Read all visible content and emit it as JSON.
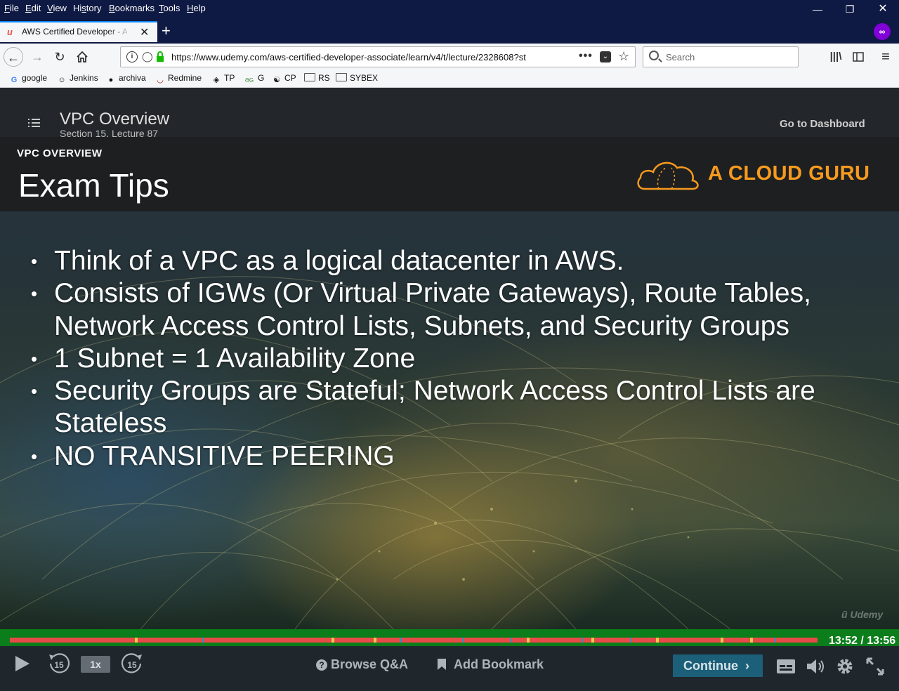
{
  "browser": {
    "menu": [
      "File",
      "Edit",
      "View",
      "History",
      "Bookmarks",
      "Tools",
      "Help"
    ],
    "menu_mnemonic": [
      "F",
      "E",
      "V",
      "s",
      "B",
      "T",
      "H"
    ],
    "tab": {
      "title": "AWS Certified Developer - A",
      "favicon": "u"
    },
    "url": "https://www.udemy.com/aws-certified-developer-associate/learn/v4/t/lecture/2328608?st",
    "search_placeholder": "Search",
    "bookmarks": [
      {
        "label": "google",
        "icon": "G"
      },
      {
        "label": "Jenkins",
        "icon": "jenkins-icon"
      },
      {
        "label": "archiva",
        "icon": "archiva-icon"
      },
      {
        "label": "Redmine",
        "icon": "redmine-icon"
      },
      {
        "label": "TP",
        "icon": "tp-icon"
      },
      {
        "label": "G",
        "icon": "g-icon"
      },
      {
        "label": "CP",
        "icon": "cp-icon"
      },
      {
        "label": "RS",
        "icon": "folder-icon"
      },
      {
        "label": "SYBEX",
        "icon": "folder-icon"
      }
    ]
  },
  "lecture": {
    "title": "VPC Overview",
    "subtitle": "Section 15, Lecture 87",
    "dashboard_label": "Go to Dashboard"
  },
  "slide": {
    "section": "VPC OVERVIEW",
    "heading": "Exam Tips",
    "brand": "A CLOUD GURU",
    "bullets": [
      [
        "Think of a VPC as a logical datacenter in AWS."
      ],
      [
        "Consists of IGWs (Or Virtual Private Gateways), Route Tables,",
        "Network Access Control Lists, Subnets, and Security Groups"
      ],
      [
        "1 Subnet = 1 Availability Zone"
      ],
      [
        "Security Groups are Stateful; Network Access Control Lists are",
        "Stateless"
      ],
      [
        "NO TRANSITIVE PEERING"
      ]
    ],
    "watermark": "Udemy"
  },
  "player": {
    "time": "13:52 / 13:56",
    "progress": 0.995,
    "speed": "1x",
    "rewind_label": "15",
    "forward_label": "15",
    "browse_qa": "Browse Q&A",
    "add_bookmark": "Add Bookmark",
    "continue": "Continue"
  },
  "colors": {
    "brand_orange": "#f79a1e",
    "progress_bar": "#e84a4a",
    "progress_bg": "#0b7d1a",
    "continue_bg": "#1b5f79",
    "private_badge": "#8000d7"
  }
}
